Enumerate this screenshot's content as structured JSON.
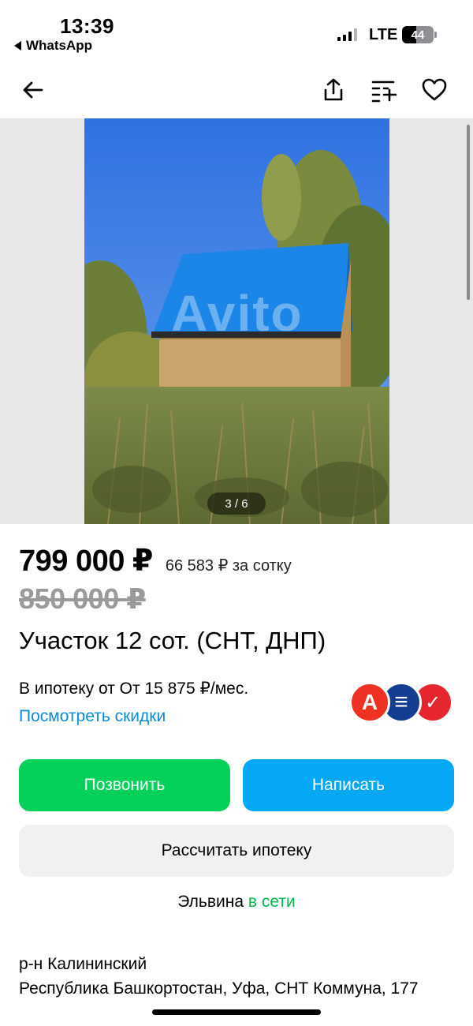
{
  "status_bar": {
    "time": "13:39",
    "back_app": "WhatsApp",
    "network": "LTE",
    "battery": "44"
  },
  "nav": {
    "icons": [
      "arrow-left-icon",
      "share-icon",
      "compare-icon",
      "heart-icon"
    ]
  },
  "gallery": {
    "counter": "3 / 6",
    "watermark": "Avito",
    "current_index": 3,
    "total": 6
  },
  "listing": {
    "price": "799 000 ₽",
    "price_per_sotka": "66 583 ₽ за сотку",
    "old_price": "850 000 ₽",
    "title": "Участок 12 сот. (СНТ, ДНП)",
    "mortgage_text": "В ипотеку от От 15 875 ₽/мес.",
    "discount_link": "Посмотреть скидки",
    "bank_logos": [
      "А",
      "≡",
      "✓"
    ]
  },
  "actions": {
    "call_label": "Позвонить",
    "write_label": "Написать",
    "mortgage_label": "Рассчитать ипотеку"
  },
  "seller": {
    "name": "Эльвина",
    "status": "в сети"
  },
  "address": {
    "district": "р-н Калининский",
    "full": "Республика Башкортостан, Уфа, СНТ Коммуна, 177"
  },
  "colors": {
    "call": "#04d15a",
    "write": "#04a8f5",
    "link": "#0a8bd8",
    "online": "#04b54e"
  }
}
